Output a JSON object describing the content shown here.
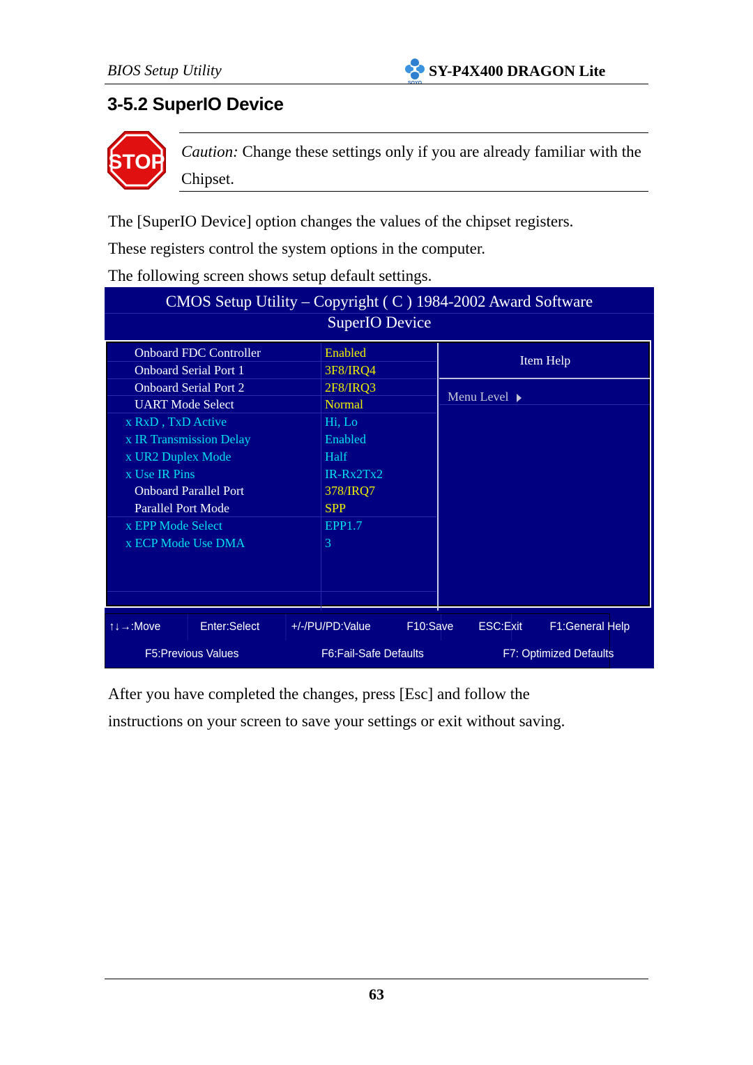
{
  "header": {
    "left_title": "BIOS Setup Utility",
    "brand_logo": "soyo-logo",
    "brand_logo_text": "SOYO",
    "model": "SY-P4X400 DRAGON Lite"
  },
  "section": {
    "title": "3-5.2  SuperIO Device"
  },
  "caution": {
    "icon": "stop-sign-icon",
    "icon_text": "STOP",
    "lead": "Caution:",
    "text": " Change these settings only if you are already familiar with the Chipset."
  },
  "intro_paragraph": [
    "The [SuperIO Device] option changes the values of the chipset registers.",
    "These registers control the system options in the computer.",
    "The following screen shows setup default settings."
  ],
  "bios": {
    "title": "CMOS Setup Utility – Copyright ( C ) 1984-2002 Award Software",
    "subtitle": "SuperIO Device",
    "colors": {
      "background": "#000080",
      "enabled_label": "#ffffff",
      "disabled_item": "#00e0f0",
      "value": "#f0f000"
    },
    "items": [
      {
        "label": "Onboard FDC Controller",
        "value": "Enabled",
        "disabled": false
      },
      {
        "label": "Onboard Serial Port 1",
        "value": "3F8/IRQ4",
        "disabled": false
      },
      {
        "label": "Onboard Serial Port 2",
        "value": "2F8/IRQ3",
        "disabled": false
      },
      {
        "label": "UART Mode Select",
        "value": "Normal",
        "disabled": false
      },
      {
        "label": "x RxD , TxD Active",
        "value": "Hi, Lo",
        "disabled": true
      },
      {
        "label": "x IR Transmission Delay",
        "value": "Enabled",
        "disabled": true
      },
      {
        "label": "x UR2 Duplex Mode",
        "value": "Half",
        "disabled": true
      },
      {
        "label": "x Use IR Pins",
        "value": "IR-Rx2Tx2",
        "disabled": true
      },
      {
        "label": "Onboard Parallel Port",
        "value": "378/IRQ7",
        "disabled": false
      },
      {
        "label": "Parallel Port Mode",
        "value": "SPP",
        "disabled": false
      },
      {
        "label": "x EPP Mode Select",
        "value": "EPP1.7",
        "disabled": true
      },
      {
        "label": "x ECP Mode Use DMA",
        "value": "3",
        "disabled": true
      }
    ],
    "help": {
      "title": "Item Help",
      "menu_level": "Menu Level",
      "menu_level_icon": "triangle-right-icon"
    },
    "keys_row1": [
      {
        "label": "↑↓→:Move"
      },
      {
        "label": "Enter:Select"
      },
      {
        "label": "+/-/PU/PD:Value"
      },
      {
        "label": "F10:Save"
      },
      {
        "label": "ESC:Exit"
      },
      {
        "label": "F1:General Help"
      }
    ],
    "keys_row2": [
      {
        "label": "F5:Previous Values"
      },
      {
        "label": "F6:Fail-Safe Defaults"
      },
      {
        "label": "F7: Optimized Defaults"
      }
    ]
  },
  "closing_paragraph": [
    "After you have completed the changes, press [Esc] and follow the",
    "instructions on your screen to save your settings or exit without saving."
  ],
  "footer": {
    "page_number": "63"
  }
}
